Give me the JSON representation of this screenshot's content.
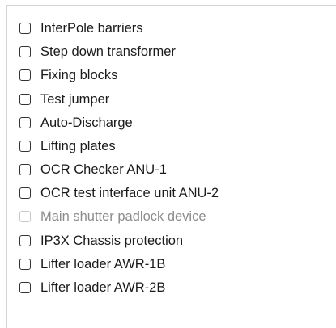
{
  "checklist": {
    "items": [
      {
        "label": "InterPole barriers",
        "checked": false,
        "enabled": true
      },
      {
        "label": "Step down transformer",
        "checked": false,
        "enabled": true
      },
      {
        "label": "Fixing blocks",
        "checked": false,
        "enabled": true
      },
      {
        "label": "Test jumper",
        "checked": false,
        "enabled": true
      },
      {
        "label": "Auto-Discharge",
        "checked": false,
        "enabled": true
      },
      {
        "label": "Lifting plates",
        "checked": false,
        "enabled": true
      },
      {
        "label": "OCR Checker ANU-1",
        "checked": false,
        "enabled": true
      },
      {
        "label": "OCR test interface unit ANU-2",
        "checked": false,
        "enabled": true
      },
      {
        "label": "Main shutter padlock device",
        "checked": false,
        "enabled": false
      },
      {
        "label": "IP3X Chassis protection",
        "checked": false,
        "enabled": true
      },
      {
        "label": "Lifter loader AWR-1B",
        "checked": false,
        "enabled": true
      },
      {
        "label": "Lifter loader AWR-2B",
        "checked": false,
        "enabled": true
      }
    ]
  }
}
